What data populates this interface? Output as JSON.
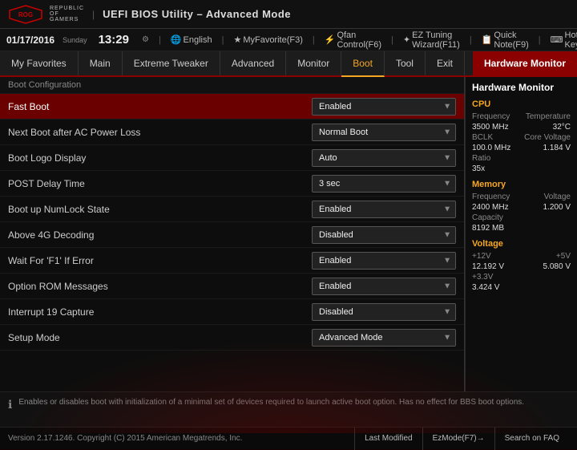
{
  "topbar": {
    "title": "UEFI BIOS Utility – Advanced Mode",
    "logo_line1": "REPUBLIC",
    "logo_line2": "OF",
    "logo_line3": "GAMERS"
  },
  "secondbar": {
    "date": "01/17/2016",
    "day": "Sunday",
    "time": "13:29",
    "language": "English",
    "myfavorite": "MyFavorite(F3)",
    "qfan": "Qfan Control(F6)",
    "eztuning": "EZ Tuning Wizard(F11)",
    "quicknote": "Quick Note(F9)",
    "hotkeys": "Hot Keys"
  },
  "nav": {
    "items": [
      {
        "label": "My Favorites",
        "active": false
      },
      {
        "label": "Main",
        "active": false
      },
      {
        "label": "Extreme Tweaker",
        "active": false
      },
      {
        "label": "Advanced",
        "active": false
      },
      {
        "label": "Monitor",
        "active": false
      },
      {
        "label": "Boot",
        "active": true
      },
      {
        "label": "Tool",
        "active": false
      },
      {
        "label": "Exit",
        "active": false
      }
    ],
    "hardware_monitor": "Hardware Monitor"
  },
  "breadcrumb": "Boot Configuration",
  "settings": [
    {
      "label": "Fast Boot",
      "value": "Enabled",
      "highlighted": true
    },
    {
      "label": "Next Boot after AC Power Loss",
      "value": "Normal Boot",
      "highlighted": false
    },
    {
      "label": "Boot Logo Display",
      "value": "Auto",
      "highlighted": false
    },
    {
      "label": "POST Delay Time",
      "value": "3 sec",
      "highlighted": false
    },
    {
      "label": "Boot up NumLock State",
      "value": "Enabled",
      "highlighted": false
    },
    {
      "label": "Above 4G Decoding",
      "value": "Disabled",
      "highlighted": false
    },
    {
      "label": "Wait For 'F1' If Error",
      "value": "Enabled",
      "highlighted": false
    },
    {
      "label": "Option ROM Messages",
      "value": "Enabled",
      "highlighted": false
    },
    {
      "label": "Interrupt 19 Capture",
      "value": "Disabled",
      "highlighted": false
    },
    {
      "label": "Setup Mode",
      "value": "Advanced Mode",
      "highlighted": false
    }
  ],
  "hardware_monitor": {
    "title": "Hardware Monitor",
    "sections": [
      {
        "title": "CPU",
        "rows": [
          {
            "label": "Frequency",
            "value": "Temperature"
          },
          {
            "label": "3500 MHz",
            "value": "32°C"
          },
          {
            "label": "BCLK",
            "value": "Core Voltage"
          },
          {
            "label": "100.0 MHz",
            "value": "1.184 V"
          },
          {
            "label": "Ratio",
            "value": ""
          },
          {
            "label": "35x",
            "value": ""
          }
        ]
      },
      {
        "title": "Memory",
        "rows": [
          {
            "label": "Frequency",
            "value": "Voltage"
          },
          {
            "label": "2400 MHz",
            "value": "1.200 V"
          },
          {
            "label": "Capacity",
            "value": ""
          },
          {
            "label": "8192 MB",
            "value": ""
          }
        ]
      },
      {
        "title": "Voltage",
        "rows": [
          {
            "label": "+12V",
            "value": "+5V"
          },
          {
            "label": "12.192 V",
            "value": "5.080 V"
          },
          {
            "label": "+3.3V",
            "value": ""
          },
          {
            "label": "3.424 V",
            "value": ""
          }
        ]
      }
    ]
  },
  "info_text": "Enables or disables boot with initialization of a minimal set of devices required to launch active boot option. Has no effect for BBS boot options.",
  "footer": {
    "copyright": "Version 2.17.1246. Copyright (C) 2015 American Megatrends, Inc.",
    "last_modified": "Last Modified",
    "ezmode": "EzMode(F7)→",
    "search_faq": "Search on FAQ"
  }
}
